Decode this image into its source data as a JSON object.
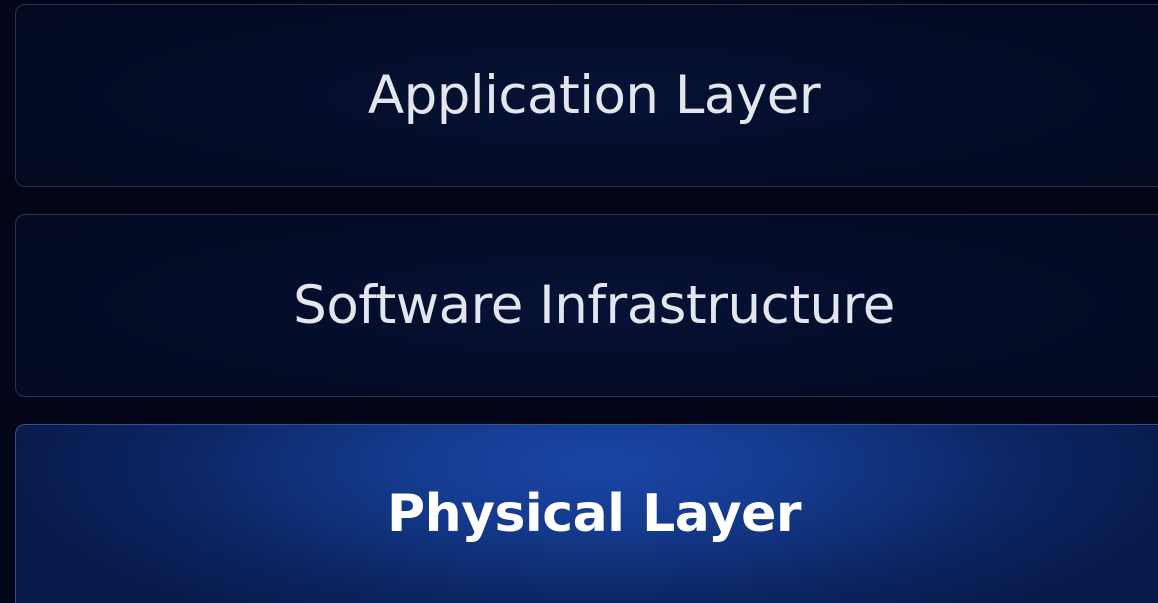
{
  "layers": [
    {
      "label": "Application Layer",
      "selected": false
    },
    {
      "label": "Software Infrastructure",
      "selected": false
    },
    {
      "label": "Physical Layer",
      "selected": true
    }
  ],
  "colors": {
    "background": "#020618",
    "card_border": "#2b3350",
    "selected_accent": "#1a46a6",
    "text": "#e3e6ee"
  }
}
